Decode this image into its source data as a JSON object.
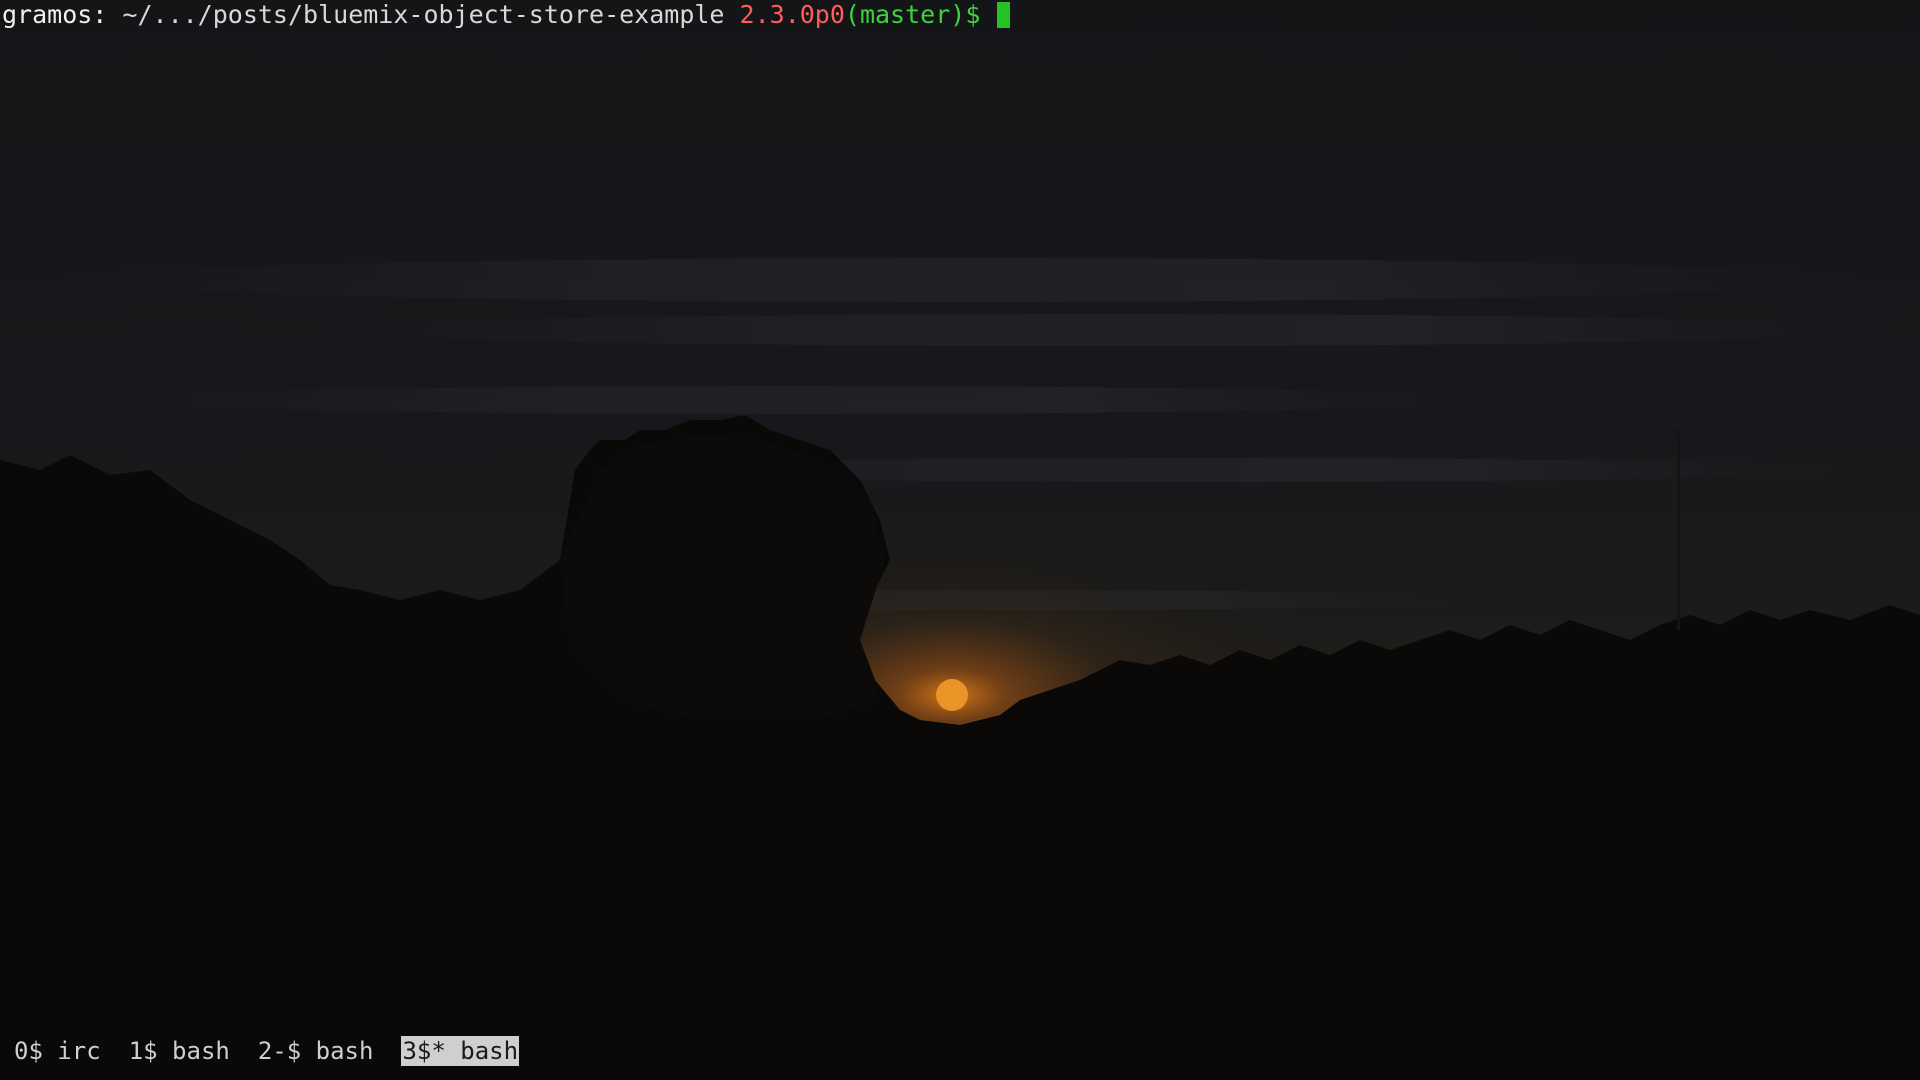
{
  "prompt": {
    "user": "gramos:",
    "path": "~/.../posts/bluemix-object-store-example",
    "version": "2.3.0p0",
    "branch": "(master)",
    "symbol": "$"
  },
  "status_bar": {
    "windows": [
      {
        "label": "0$ irc",
        "active": false
      },
      {
        "label": "1$ bash",
        "active": false
      },
      {
        "label": "2-$ bash",
        "active": false
      },
      {
        "label": "3$* bash",
        "active": true
      }
    ]
  },
  "colors": {
    "prompt_user": "#f0f0f0",
    "prompt_version": "#ff5c5c",
    "prompt_branch": "#3ed23e",
    "cursor": "#22c322",
    "status_active_bg": "#cfcfcf"
  },
  "wallpaper": {
    "subject": "sunset-silhouette-trees"
  }
}
